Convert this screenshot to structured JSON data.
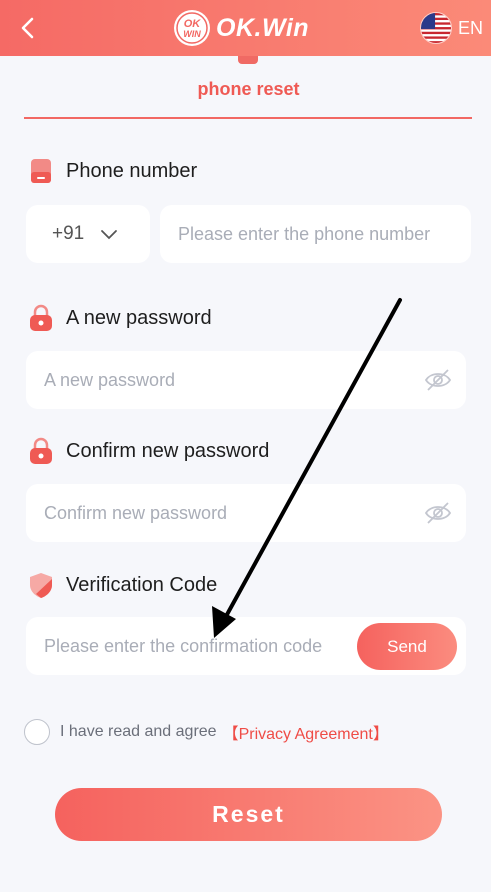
{
  "header": {
    "logo_badge": "OK WIN",
    "logo_text": "OK.Win",
    "language": "EN",
    "icons": [
      "back-arrow-icon",
      "us-flag-icon"
    ]
  },
  "tab": {
    "title": "phone reset"
  },
  "phone": {
    "label": "Phone number",
    "country_code": "+91",
    "placeholder": "Please enter the phone number"
  },
  "new_password": {
    "label": "A new password",
    "placeholder": "A new password"
  },
  "confirm_password": {
    "label": "Confirm new password",
    "placeholder": "Confirm new password"
  },
  "verification": {
    "label": "Verification Code",
    "placeholder": "Please enter the confirmation code",
    "send_label": "Send"
  },
  "agreement": {
    "text": "I have read and agree",
    "link": "【Privacy Agreement】"
  },
  "reset_label": "Reset",
  "colors": {
    "accent": "#f26863",
    "accent_light": "#fb8a78",
    "background": "#f6f7fb"
  }
}
